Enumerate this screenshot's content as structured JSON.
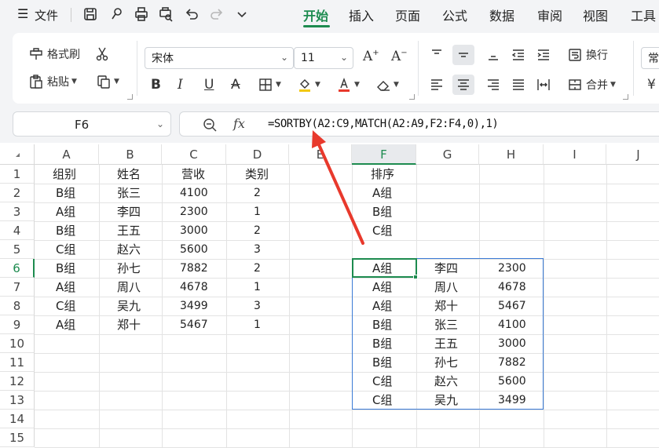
{
  "menubar": {
    "menu_icon": "hamburger-icon",
    "file_label": "文件",
    "quick_access": [
      "save-icon",
      "format-painter-icon",
      "print-icon",
      "print-preview-icon",
      "undo-icon",
      "redo-icon",
      "more-icon"
    ],
    "tabs": [
      "开始",
      "插入",
      "页面",
      "公式",
      "数据",
      "审阅",
      "视图",
      "工具"
    ],
    "active_tab": "开始",
    "accent_color": "#1d8b4f"
  },
  "ribbon": {
    "format_painter_label": "格式刷",
    "paste_label": "粘贴",
    "font_name": "宋体",
    "font_size": "11",
    "wrap_label": "换行",
    "merge_label": "合并",
    "cut_icon": "scissors-icon",
    "copy_icon": "copy-icon",
    "bold": "B",
    "italic": "I",
    "underline": "U",
    "strike": "A",
    "grow": "A",
    "shrink": "A",
    "number_format_partial": "常",
    "currency_partial": "¥"
  },
  "formula_bar": {
    "name_box": "F6",
    "fx_label": "fx",
    "formula": "=SORTBY(A2:C9,MATCH(A2:A9,F2:F4,0),1)"
  },
  "grid": {
    "columns": [
      "A",
      "B",
      "C",
      "D",
      "E",
      "F",
      "G",
      "H",
      "I",
      "J"
    ],
    "active_column": "F",
    "rows": [
      "1",
      "2",
      "3",
      "4",
      "5",
      "6",
      "7",
      "8",
      "9",
      "10",
      "11",
      "12",
      "13",
      "14",
      "15"
    ],
    "active_row": "6",
    "table_header": [
      "组别",
      "姓名",
      "营收",
      "类别"
    ],
    "table_rows": [
      [
        "B组",
        "张三",
        "4100",
        "2"
      ],
      [
        "A组",
        "李四",
        "2300",
        "1"
      ],
      [
        "B组",
        "王五",
        "3000",
        "2"
      ],
      [
        "C组",
        "赵六",
        "5600",
        "3"
      ],
      [
        "B组",
        "孙七",
        "7882",
        "2"
      ],
      [
        "A组",
        "周八",
        "4678",
        "1"
      ],
      [
        "C组",
        "吴九",
        "3499",
        "3"
      ],
      [
        "A组",
        "郑十",
        "5467",
        "1"
      ]
    ],
    "sort_header": "排序",
    "sort_order": [
      "A组",
      "B组",
      "C组"
    ],
    "result_rows": [
      [
        "A组",
        "李四",
        "2300"
      ],
      [
        "A组",
        "周八",
        "4678"
      ],
      [
        "A组",
        "郑十",
        "5467"
      ],
      [
        "B组",
        "张三",
        "4100"
      ],
      [
        "B组",
        "王五",
        "3000"
      ],
      [
        "B组",
        "孙七",
        "7882"
      ],
      [
        "C组",
        "赵六",
        "5600"
      ],
      [
        "C组",
        "吴九",
        "3499"
      ]
    ],
    "selection_color": "#3b7bd6",
    "annotation_arrow_color": "#e8392c"
  }
}
